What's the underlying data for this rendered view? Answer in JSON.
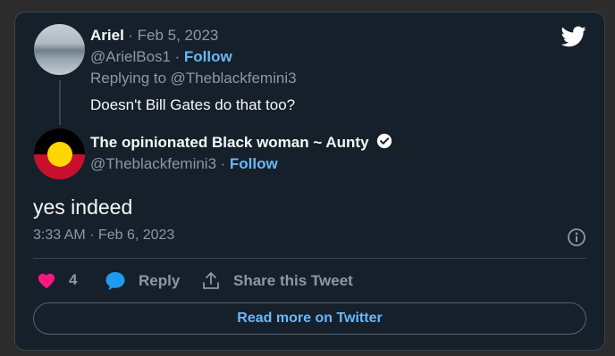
{
  "reply": {
    "author_name": "Ariel",
    "date": "Feb 5, 2023",
    "handle": "@ArielBos1",
    "follow_label": "Follow",
    "replying_to_prefix": "Replying to",
    "replying_to_handle": "@Theblackfemini3",
    "text": "Doesn't Bill Gates do that too?"
  },
  "tweet": {
    "author_name": "The opinionated Black woman ~ Aunty",
    "handle": "@Theblackfemini3",
    "follow_label": "Follow",
    "text": "yes indeed",
    "timestamp": "3:33 AM · Feb 6, 2023"
  },
  "actions": {
    "like_count": "4",
    "reply_label": "Reply",
    "share_label": "Share this Tweet"
  },
  "read_more_label": "Read more on Twitter",
  "icons": {
    "logo": "twitter-bird-icon",
    "verified": "verified-badge-icon",
    "info": "info-icon",
    "like": "heart-icon",
    "reply": "speech-bubble-icon",
    "share": "share-upload-icon"
  },
  "colors": {
    "background": "#15202b",
    "link": "#6ab7f5",
    "muted": "#8b98a5",
    "heart": "#f91880",
    "reply_bubble": "#1d9bf0"
  }
}
